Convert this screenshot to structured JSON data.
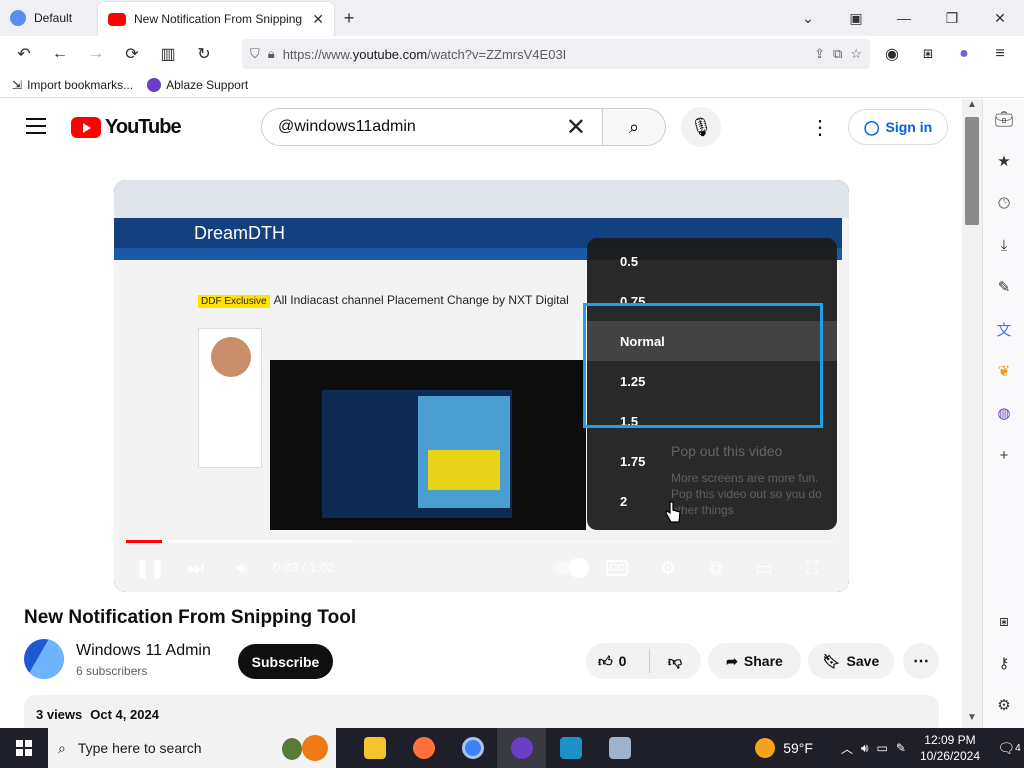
{
  "browser": {
    "tabs": [
      {
        "label": "Default",
        "active": false
      },
      {
        "label": "New Notification From Snipping",
        "active": true
      }
    ],
    "url_prefix": "https://www.",
    "url_domain": "youtube.com",
    "url_path": "/watch?v=ZZmrsV4E03I",
    "bookmarks": [
      {
        "label": "Import bookmarks...",
        "icon": "import-icon"
      },
      {
        "label": "Ablaze Support",
        "icon": "ablaze-icon"
      }
    ]
  },
  "youtube": {
    "logo_text": "YouTube",
    "search_value": "@windows11admin",
    "sign_in": "Sign in"
  },
  "video": {
    "inner_logo": "DreamDTH",
    "inner_badge": "DDF Exclusive",
    "inner_title": "All Indiacast channel Placement Change by NXT Digital",
    "speed_options": [
      "0.5",
      "0.75",
      "Normal",
      "1.25",
      "1.5",
      "1.75",
      "2"
    ],
    "speed_current": "Normal",
    "popout_title": "Pop out this video",
    "popout_desc": "More screens are more fun. Pop this video out so you do other things",
    "time": "0:03 / 1:02",
    "progress_played_fraction": 0.05,
    "progress_buffered_fraction": 0.32
  },
  "meta": {
    "title": "New Notification From Snipping Tool",
    "channel": "Windows 11 Admin",
    "subscribers": "6 subscribers",
    "subscribe": "Subscribe",
    "likes": "0",
    "share": "Share",
    "save": "Save",
    "views": "3 views",
    "date": "Oct 4, 2024"
  },
  "taskbar": {
    "search_placeholder": "Type here to search",
    "temperature": "59°F",
    "time": "12:09 PM",
    "date": "10/26/2024",
    "notifications": "4"
  },
  "colors": {
    "yt_red": "#ff0000",
    "highlight": "#1aa3e8",
    "link_blue": "#065fd4"
  }
}
